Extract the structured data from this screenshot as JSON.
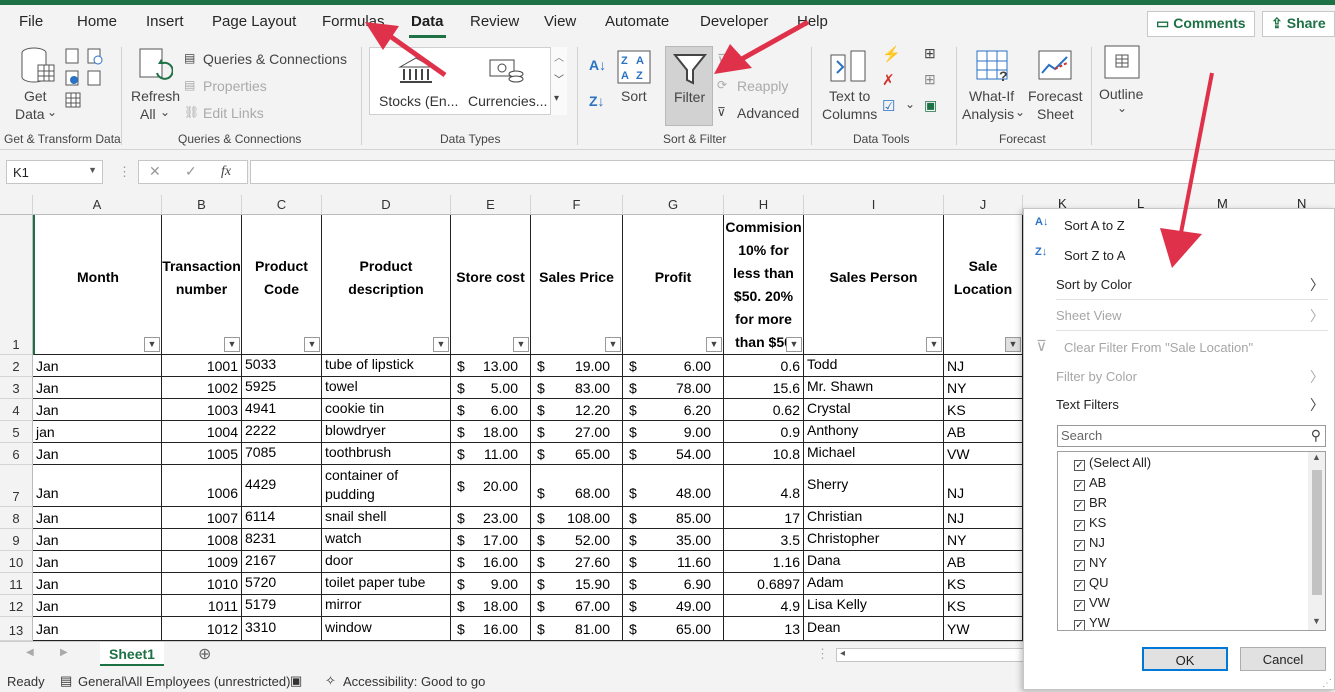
{
  "menu": {
    "tabs": [
      "File",
      "Home",
      "Insert",
      "Page Layout",
      "Formulas",
      "Data",
      "Review",
      "View",
      "Automate",
      "Developer",
      "Help"
    ],
    "active": "Data",
    "comments_label": "Comments",
    "share_label": "Share"
  },
  "ribbon": {
    "get_data": "Get",
    "get_data2": "Data",
    "refresh": "Refresh",
    "refresh2": "All",
    "queries_connections": "Queries & Connections",
    "properties": "Properties",
    "edit_links": "Edit Links",
    "stocks": "Stocks (En...",
    "currencies": "Currencies...",
    "sort": "Sort",
    "filter": "Filter",
    "reapply": "Reapply",
    "advanced": "Advanced",
    "text_to_columns": "Text to",
    "text_to_columns2": "Columns",
    "what_if": "What-If",
    "what_if2": "Analysis",
    "forecast_sheet": "Forecast",
    "forecast_sheet2": "Sheet",
    "outline": "Outline",
    "groups": {
      "get_transform": "Get & Transform Data",
      "queries": "Queries & Connections",
      "data_types": "Data Types",
      "sort_filter": "Sort & Filter",
      "data_tools": "Data Tools",
      "forecast": "Forecast"
    }
  },
  "formula_bar": {
    "name_box": "K1",
    "fx": "fx",
    "formula": ""
  },
  "grid": {
    "columns": [
      "A",
      "B",
      "C",
      "D",
      "E",
      "F",
      "G",
      "H",
      "I",
      "J",
      "K",
      "L",
      "M",
      "N"
    ],
    "headers": [
      "Month",
      "Transaction number",
      "Product Code",
      "Product description",
      "Store cost",
      "Sales Price",
      "Profit",
      "Commision 10% for less than $50. 20% for more than $50",
      "Sales Person",
      "Sale Location"
    ],
    "rows": [
      {
        "n": "2",
        "month": "Jan",
        "tn": "1001",
        "code": "5033",
        "desc": "tube  of  lipstick",
        "cost": "13.00",
        "price": "19.00",
        "profit": "6.00",
        "comm": "0.6",
        "person": "Todd",
        "loc": "NJ"
      },
      {
        "n": "3",
        "month": "Jan",
        "tn": "1002",
        "code": "5925",
        "desc": "towel",
        "cost": "5.00",
        "price": "83.00",
        "profit": "78.00",
        "comm": "15.6",
        "person": "Mr. Shawn",
        "loc": "NY"
      },
      {
        "n": "4",
        "month": "Jan",
        "tn": "1003",
        "code": "4941",
        "desc": "cookie tin",
        "cost": "6.00",
        "price": "12.20",
        "profit": "6.20",
        "comm": "0.62",
        "person": "Crystal",
        "loc": "KS"
      },
      {
        "n": "5",
        "month": "jan",
        "tn": "1004",
        "code": "2222",
        "desc": "blowdryer",
        "cost": "18.00",
        "price": "27.00",
        "profit": "9.00",
        "comm": "0.9",
        "person": "Anthony",
        "loc": "AB"
      },
      {
        "n": "6",
        "month": "Jan",
        "tn": "1005",
        "code": "7085",
        "desc": "toothbrush",
        "cost": "11.00",
        "price": "65.00",
        "profit": "54.00",
        "comm": "10.8",
        "person": "Michael",
        "loc": "VW"
      },
      {
        "n": "7",
        "month": "Jan",
        "tn": "1006",
        "code": "4429",
        "desc": "container of pudding",
        "cost": "20.00",
        "price": "68.00",
        "profit": "48.00",
        "comm": "4.8",
        "person": "Sherry",
        "loc": "NJ"
      },
      {
        "n": "8",
        "month": "Jan",
        "tn": "1007",
        "code": "6114",
        "desc": "snail  shell",
        "cost": "23.00",
        "price": "108.00",
        "profit": "85.00",
        "comm": "17",
        "person": "Christian",
        "loc": "NJ"
      },
      {
        "n": "9",
        "month": "Jan",
        "tn": "1008",
        "code": "8231",
        "desc": "watch",
        "cost": "17.00",
        "price": "52.00",
        "profit": "35.00",
        "comm": "3.5",
        "person": "Christopher",
        "loc": "NY"
      },
      {
        "n": "10",
        "month": "Jan",
        "tn": "1009",
        "code": "2167",
        "desc": "door",
        "cost": "16.00",
        "price": "27.60",
        "profit": "11.60",
        "comm": "1.16",
        "person": "Dana",
        "loc": "AB"
      },
      {
        "n": "11",
        "month": "Jan",
        "tn": "1010",
        "code": "5720",
        "desc": "toilet paper tube",
        "cost": "9.00",
        "price": "15.90",
        "profit": "6.90",
        "comm": "0.6897",
        "person": "Adam",
        "loc": "KS"
      },
      {
        "n": "12",
        "month": "Jan",
        "tn": "1011",
        "code": "5179",
        "desc": "mirror",
        "cost": "18.00",
        "price": "67.00",
        "profit": "49.00",
        "comm": "4.9",
        "person": "Lisa Kelly",
        "loc": "KS"
      },
      {
        "n": "13",
        "month": "Jan",
        "tn": "1012",
        "code": "3310",
        "desc": "window",
        "cost": "16.00",
        "price": "81.00",
        "profit": "65.00",
        "comm": "13",
        "person": "Dean",
        "loc": "YW"
      }
    ],
    "currency": "$"
  },
  "sheet": {
    "tab": "Sheet1"
  },
  "status": {
    "ready": "Ready",
    "sensitivity": "General\\All Employees (unrestricted)",
    "accessibility": "Accessibility: Good to go"
  },
  "filter_panel": {
    "sort_az": "Sort A to Z",
    "sort_za": "Sort Z to A",
    "sort_color": "Sort by Color",
    "sheet_view": "Sheet View",
    "clear_filter": "Clear Filter From \"Sale Location\"",
    "filter_color": "Filter by Color",
    "text_filters": "Text Filters",
    "search_placeholder": "Search",
    "items": [
      "(Select All)",
      "AB",
      "BR",
      "KS",
      "NJ",
      "NY",
      "QU",
      "VW",
      "YW"
    ],
    "ok": "OK",
    "cancel": "Cancel"
  },
  "colors": {
    "accent": "#1e7145",
    "annotation_arrow": "#e0314b"
  }
}
